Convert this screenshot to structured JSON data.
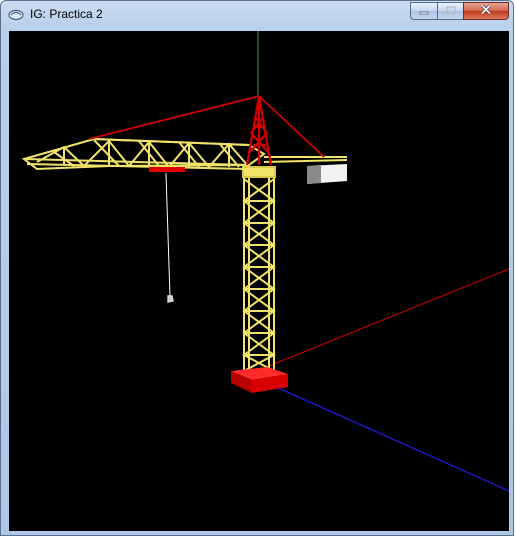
{
  "window": {
    "title": "IG: Practica 2",
    "icon": "opengl-app-icon",
    "controls": [
      "minimize-icon",
      "maximize-icon",
      "close-icon"
    ]
  },
  "scene": {
    "background": "#000000",
    "colors": {
      "axis_x": "#cc0000",
      "axis_y": "#2fa82f",
      "axis_z": "#1a1acc",
      "truss": "#f2e46a",
      "cables": "#cc0000",
      "base": "#e00000",
      "counterweight": "#e6e6e6",
      "hook_cable": "#ffffff"
    }
  }
}
